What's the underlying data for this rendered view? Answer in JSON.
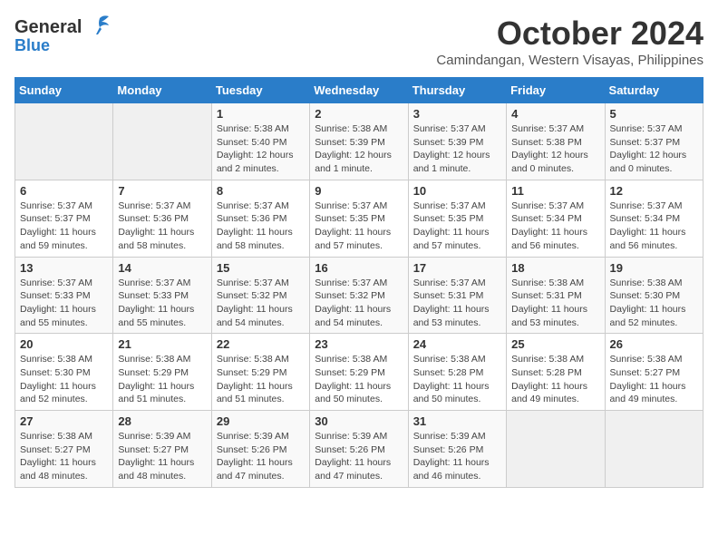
{
  "logo": {
    "line1": "General",
    "line2": "Blue"
  },
  "title": "October 2024",
  "location": "Camindangan, Western Visayas, Philippines",
  "headers": [
    "Sunday",
    "Monday",
    "Tuesday",
    "Wednesday",
    "Thursday",
    "Friday",
    "Saturday"
  ],
  "weeks": [
    [
      {
        "day": "",
        "info": ""
      },
      {
        "day": "",
        "info": ""
      },
      {
        "day": "1",
        "info": "Sunrise: 5:38 AM\nSunset: 5:40 PM\nDaylight: 12 hours\nand 2 minutes."
      },
      {
        "day": "2",
        "info": "Sunrise: 5:38 AM\nSunset: 5:39 PM\nDaylight: 12 hours\nand 1 minute."
      },
      {
        "day": "3",
        "info": "Sunrise: 5:37 AM\nSunset: 5:39 PM\nDaylight: 12 hours\nand 1 minute."
      },
      {
        "day": "4",
        "info": "Sunrise: 5:37 AM\nSunset: 5:38 PM\nDaylight: 12 hours\nand 0 minutes."
      },
      {
        "day": "5",
        "info": "Sunrise: 5:37 AM\nSunset: 5:37 PM\nDaylight: 12 hours\nand 0 minutes."
      }
    ],
    [
      {
        "day": "6",
        "info": "Sunrise: 5:37 AM\nSunset: 5:37 PM\nDaylight: 11 hours\nand 59 minutes."
      },
      {
        "day": "7",
        "info": "Sunrise: 5:37 AM\nSunset: 5:36 PM\nDaylight: 11 hours\nand 58 minutes."
      },
      {
        "day": "8",
        "info": "Sunrise: 5:37 AM\nSunset: 5:36 PM\nDaylight: 11 hours\nand 58 minutes."
      },
      {
        "day": "9",
        "info": "Sunrise: 5:37 AM\nSunset: 5:35 PM\nDaylight: 11 hours\nand 57 minutes."
      },
      {
        "day": "10",
        "info": "Sunrise: 5:37 AM\nSunset: 5:35 PM\nDaylight: 11 hours\nand 57 minutes."
      },
      {
        "day": "11",
        "info": "Sunrise: 5:37 AM\nSunset: 5:34 PM\nDaylight: 11 hours\nand 56 minutes."
      },
      {
        "day": "12",
        "info": "Sunrise: 5:37 AM\nSunset: 5:34 PM\nDaylight: 11 hours\nand 56 minutes."
      }
    ],
    [
      {
        "day": "13",
        "info": "Sunrise: 5:37 AM\nSunset: 5:33 PM\nDaylight: 11 hours\nand 55 minutes."
      },
      {
        "day": "14",
        "info": "Sunrise: 5:37 AM\nSunset: 5:33 PM\nDaylight: 11 hours\nand 55 minutes."
      },
      {
        "day": "15",
        "info": "Sunrise: 5:37 AM\nSunset: 5:32 PM\nDaylight: 11 hours\nand 54 minutes."
      },
      {
        "day": "16",
        "info": "Sunrise: 5:37 AM\nSunset: 5:32 PM\nDaylight: 11 hours\nand 54 minutes."
      },
      {
        "day": "17",
        "info": "Sunrise: 5:37 AM\nSunset: 5:31 PM\nDaylight: 11 hours\nand 53 minutes."
      },
      {
        "day": "18",
        "info": "Sunrise: 5:38 AM\nSunset: 5:31 PM\nDaylight: 11 hours\nand 53 minutes."
      },
      {
        "day": "19",
        "info": "Sunrise: 5:38 AM\nSunset: 5:30 PM\nDaylight: 11 hours\nand 52 minutes."
      }
    ],
    [
      {
        "day": "20",
        "info": "Sunrise: 5:38 AM\nSunset: 5:30 PM\nDaylight: 11 hours\nand 52 minutes."
      },
      {
        "day": "21",
        "info": "Sunrise: 5:38 AM\nSunset: 5:29 PM\nDaylight: 11 hours\nand 51 minutes."
      },
      {
        "day": "22",
        "info": "Sunrise: 5:38 AM\nSunset: 5:29 PM\nDaylight: 11 hours\nand 51 minutes."
      },
      {
        "day": "23",
        "info": "Sunrise: 5:38 AM\nSunset: 5:29 PM\nDaylight: 11 hours\nand 50 minutes."
      },
      {
        "day": "24",
        "info": "Sunrise: 5:38 AM\nSunset: 5:28 PM\nDaylight: 11 hours\nand 50 minutes."
      },
      {
        "day": "25",
        "info": "Sunrise: 5:38 AM\nSunset: 5:28 PM\nDaylight: 11 hours\nand 49 minutes."
      },
      {
        "day": "26",
        "info": "Sunrise: 5:38 AM\nSunset: 5:27 PM\nDaylight: 11 hours\nand 49 minutes."
      }
    ],
    [
      {
        "day": "27",
        "info": "Sunrise: 5:38 AM\nSunset: 5:27 PM\nDaylight: 11 hours\nand 48 minutes."
      },
      {
        "day": "28",
        "info": "Sunrise: 5:39 AM\nSunset: 5:27 PM\nDaylight: 11 hours\nand 48 minutes."
      },
      {
        "day": "29",
        "info": "Sunrise: 5:39 AM\nSunset: 5:26 PM\nDaylight: 11 hours\nand 47 minutes."
      },
      {
        "day": "30",
        "info": "Sunrise: 5:39 AM\nSunset: 5:26 PM\nDaylight: 11 hours\nand 47 minutes."
      },
      {
        "day": "31",
        "info": "Sunrise: 5:39 AM\nSunset: 5:26 PM\nDaylight: 11 hours\nand 46 minutes."
      },
      {
        "day": "",
        "info": ""
      },
      {
        "day": "",
        "info": ""
      }
    ]
  ]
}
